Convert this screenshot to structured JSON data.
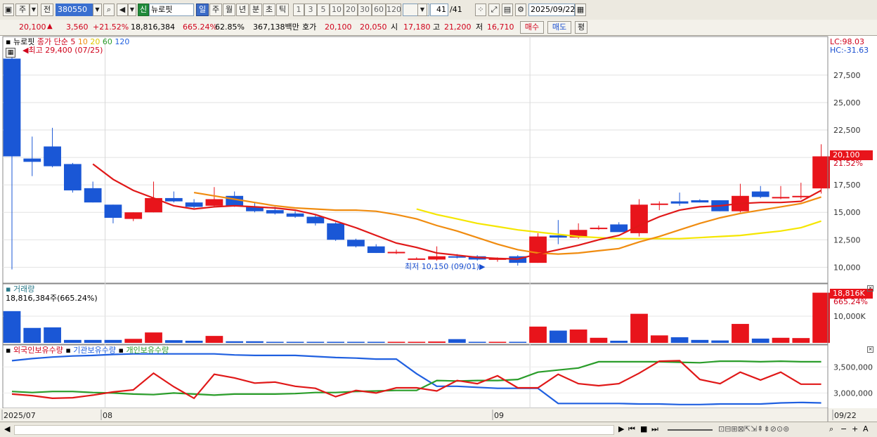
{
  "toolbar": {
    "period_main": "주",
    "prev_label": "전",
    "code": "380550",
    "stock_badge": "신",
    "stock_name": "뉴로핏",
    "periods": [
      "일",
      "주",
      "월",
      "년",
      "분",
      "초",
      "틱"
    ],
    "active_period": "일",
    "numbers": [
      "1",
      "3",
      "5",
      "10",
      "20",
      "30",
      "60",
      "120"
    ],
    "count": "41",
    "count_total": "/41",
    "date": "2025/09/22"
  },
  "quote": {
    "price": "20,100",
    "change": "3,560",
    "change_pct": "+21.52%",
    "volume": "18,816,384",
    "volume_pct": "665.24%",
    "ratio": "62.85%",
    "amount": "367,138백만",
    "bid_label": "호가",
    "ask": "20,100",
    "bid": "20,050",
    "open_label": "시",
    "open": "17,180",
    "high_label": "고",
    "high": "21,200",
    "low_label": "저",
    "low": "16,710",
    "buy_btn": "매수",
    "sell_btn": "매도",
    "eval_btn": "평"
  },
  "legend": {
    "name": "뉴로핏",
    "close_label": "종가 단순",
    "ma_labels": [
      "5",
      "10",
      "20",
      "60",
      "120"
    ],
    "high_note": "최고 29,400 (07/25)",
    "low_note": "최저 10,150 (09/01)",
    "lc": "LC:98.03",
    "hc": "HC:-31.63",
    "last_price": "20,100",
    "last_pct": "21.52%"
  },
  "volume_panel": {
    "title": "거래량",
    "info": "18,816,384주(665.24%)",
    "last_label": "18,816K",
    "last_pct": "665.24%",
    "axis_label": "10,000K"
  },
  "holding_panel": {
    "legend": [
      "외국인보유수량",
      "기관보유수량",
      "개인보유수량"
    ],
    "axis": [
      "3,500,000",
      "3,000,000"
    ]
  },
  "x_axis": {
    "labels": [
      "2025/07",
      "08",
      "09",
      "09/22"
    ]
  },
  "colors": {
    "up": "#e8141b",
    "down": "#1a57d6",
    "ma5": "#e01818",
    "ma10": "#f08c10",
    "ma20": "#f5e600",
    "ma60": "#2a9d2a",
    "ma120": "#2060e0"
  },
  "chart_data": {
    "type": "candlestick",
    "x": [
      "07/25",
      "07/28",
      "07/29",
      "07/30",
      "07/31",
      "08/01",
      "08/04",
      "08/05",
      "08/06",
      "08/07",
      "08/08",
      "08/11",
      "08/12",
      "08/13",
      "08/14",
      "08/18",
      "08/19",
      "08/20",
      "08/21",
      "08/22",
      "08/25",
      "08/26",
      "08/27",
      "08/28",
      "08/29",
      "09/01",
      "09/02",
      "09/03",
      "09/04",
      "09/05",
      "09/08",
      "09/09",
      "09/10",
      "09/11",
      "09/12",
      "09/15",
      "09/16",
      "09/17",
      "09/18",
      "09/19",
      "09/22"
    ],
    "ohlc": [
      [
        29000,
        29400,
        9800,
        20100
      ],
      [
        19900,
        21900,
        18300,
        19600
      ],
      [
        21000,
        22700,
        19100,
        19200
      ],
      [
        19400,
        19500,
        16800,
        17000
      ],
      [
        17200,
        17800,
        15900,
        15900
      ],
      [
        15700,
        15700,
        14000,
        14500
      ],
      [
        14400,
        15000,
        14200,
        15000
      ],
      [
        15000,
        17800,
        15000,
        16300
      ],
      [
        16300,
        16900,
        15900,
        16000
      ],
      [
        15900,
        16200,
        15400,
        15500
      ],
      [
        15600,
        17300,
        15500,
        16200
      ],
      [
        16500,
        16900,
        15500,
        15600
      ],
      [
        15500,
        15900,
        15000,
        15100
      ],
      [
        15200,
        15500,
        14800,
        14900
      ],
      [
        14900,
        15100,
        14500,
        14600
      ],
      [
        14600,
        14800,
        13800,
        14000
      ],
      [
        14000,
        14100,
        12400,
        12500
      ],
      [
        12500,
        12600,
        11800,
        11900
      ],
      [
        11900,
        12100,
        11300,
        11300
      ],
      [
        11300,
        11600,
        11200,
        11400
      ],
      [
        10800,
        10900,
        10700,
        10800
      ],
      [
        10700,
        11900,
        10600,
        11000
      ],
      [
        11000,
        11200,
        10800,
        10900
      ],
      [
        11000,
        11100,
        10600,
        10700
      ],
      [
        10700,
        10900,
        10500,
        10800
      ],
      [
        11000,
        11100,
        10150,
        10400
      ],
      [
        10400,
        13100,
        10400,
        12800
      ],
      [
        12900,
        14300,
        12100,
        12700
      ],
      [
        12700,
        14000,
        12600,
        13400
      ],
      [
        13500,
        13800,
        13400,
        13600
      ],
      [
        13900,
        14100,
        13300,
        13200
      ],
      [
        13100,
        16200,
        12800,
        15700
      ],
      [
        15700,
        16000,
        15200,
        15800
      ],
      [
        16000,
        16800,
        15600,
        15800
      ],
      [
        16100,
        16200,
        15900,
        15900
      ],
      [
        16100,
        16100,
        15100,
        15100
      ],
      [
        15100,
        17600,
        15000,
        16500
      ],
      [
        16900,
        17400,
        16300,
        16400
      ],
      [
        16300,
        17400,
        16200,
        16400
      ],
      [
        16400,
        17700,
        16200,
        16500
      ],
      [
        17180,
        21200,
        16710,
        20100
      ]
    ],
    "volume_k": [
      11900,
      5600,
      5800,
      1100,
      1100,
      1100,
      1500,
      3900,
      1000,
      800,
      2600,
      600,
      600,
      400,
      400,
      400,
      400,
      400,
      400,
      400,
      400,
      500,
      1400,
      400,
      400,
      400,
      6100,
      4600,
      5000,
      1900,
      800,
      10900,
      2800,
      2100,
      1100,
      900,
      7100,
      1600,
      1900,
      1800,
      18816
    ],
    "ma5": [
      null,
      null,
      null,
      null,
      19400,
      18000,
      17000,
      16300,
      15600,
      15300,
      15500,
      15600,
      15500,
      15400,
      15200,
      14800,
      14200,
      13600,
      12900,
      12200,
      11800,
      11300,
      11100,
      10900,
      10800,
      10750,
      11200,
      11600,
      12000,
      12500,
      12900,
      13800,
      14600,
      15200,
      15500,
      15600,
      15800,
      15900,
      15900,
      16000,
      17000
    ],
    "ma10": [
      null,
      null,
      null,
      null,
      null,
      null,
      null,
      null,
      null,
      16800,
      16500,
      16200,
      15900,
      15600,
      15400,
      15300,
      15200,
      15200,
      15100,
      14800,
      14400,
      13800,
      13300,
      12700,
      12100,
      11600,
      11300,
      11200,
      11300,
      11500,
      11700,
      12300,
      12800,
      13400,
      14000,
      14500,
      14900,
      15200,
      15500,
      15800,
      16400
    ],
    "ma20": [
      null,
      null,
      null,
      null,
      null,
      null,
      null,
      null,
      null,
      null,
      null,
      null,
      null,
      null,
      null,
      null,
      null,
      null,
      null,
      null,
      15300,
      14800,
      14400,
      14000,
      13700,
      13400,
      13200,
      13000,
      12800,
      12700,
      12600,
      12600,
      12600,
      12600,
      12700,
      12800,
      12900,
      13100,
      13300,
      13600,
      14200
    ],
    "foreign_holding": [
      2980000,
      2950000,
      2900000,
      2910000,
      2960000,
      3020000,
      3060000,
      3380000,
      3120000,
      2900000,
      3360000,
      3290000,
      3190000,
      3210000,
      3130000,
      3090000,
      2930000,
      3050000,
      3000000,
      3100000,
      3100000,
      3040000,
      3240000,
      3180000,
      3330000,
      3100000,
      3100000,
      3360000,
      3180000,
      3140000,
      3180000,
      3380000,
      3610000,
      3620000,
      3260000,
      3180000,
      3400000,
      3250000,
      3400000,
      3170000,
      3170000
    ],
    "institution_holding": [
      3620000,
      3660000,
      3690000,
      3710000,
      3720000,
      3740000,
      3750000,
      3750000,
      3750000,
      3750000,
      3750000,
      3730000,
      3720000,
      3720000,
      3720000,
      3700000,
      3680000,
      3670000,
      3650000,
      3650000,
      3370000,
      3130000,
      3130000,
      3110000,
      3090000,
      3090000,
      3090000,
      2800000,
      2800000,
      2800000,
      2800000,
      2790000,
      2790000,
      2780000,
      2780000,
      2790000,
      2790000,
      2790000,
      2810000,
      2820000,
      2810000
    ],
    "individual_holding": [
      3030000,
      3010000,
      3030000,
      3030000,
      3010000,
      3000000,
      2980000,
      2970000,
      3000000,
      2980000,
      2960000,
      2980000,
      2980000,
      2980000,
      2990000,
      3010000,
      3010000,
      3030000,
      3040000,
      3050000,
      3050000,
      3240000,
      3230000,
      3240000,
      3240000,
      3260000,
      3400000,
      3440000,
      3480000,
      3600000,
      3600000,
      3600000,
      3600000,
      3590000,
      3580000,
      3610000,
      3610000,
      3600000,
      3610000,
      3600000,
      3600000
    ],
    "y_ticks": [
      10000,
      12500,
      15000,
      17500,
      20000,
      22500,
      25000,
      27500
    ],
    "ylim": [
      9000,
      30500
    ]
  }
}
